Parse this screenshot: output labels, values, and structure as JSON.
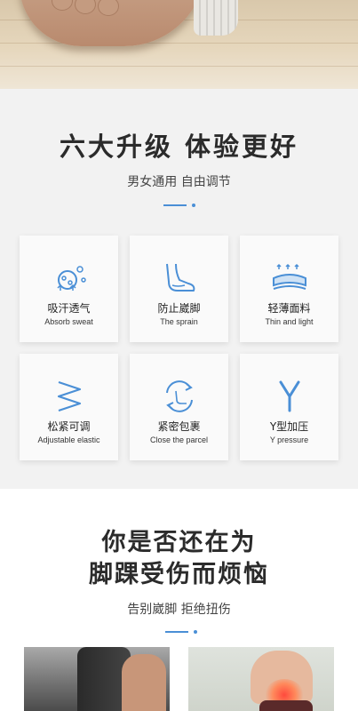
{
  "section1": {
    "title": "六大升级 体验更好",
    "subtitle": "男女通用 自由调节",
    "features": [
      {
        "cn": "吸汗透气",
        "en": "Absorb sweat",
        "icon": "sweat-bubbles-icon"
      },
      {
        "cn": "防止崴脚",
        "en": "The sprain",
        "icon": "foot-icon"
      },
      {
        "cn": "轻薄面料",
        "en": "Thin and light",
        "icon": "fabric-layer-icon"
      },
      {
        "cn": "松紧可调",
        "en": "Adjustable elastic",
        "icon": "zigzag-elastic-icon"
      },
      {
        "cn": "紧密包裹",
        "en": "Close the parcel",
        "icon": "wrap-cycle-icon"
      },
      {
        "cn": "Y型加压",
        "en": "Y pressure",
        "icon": "letter-y-icon"
      }
    ]
  },
  "section2": {
    "title_line1": "你是否还在为",
    "title_line2": "脚踝受伤而烦恼",
    "subtitle": "告别崴脚 拒绝扭伤"
  },
  "colors": {
    "accent": "#4a8fd6",
    "section_bg": "#f2f2f2",
    "card_bg": "#fafafa",
    "title": "#2b2b2b"
  }
}
